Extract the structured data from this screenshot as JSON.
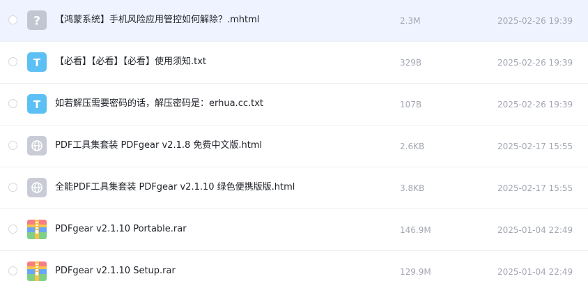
{
  "files": [
    {
      "name": "【鸿蒙系统】手机风险应用管控如何解除？.mhtml",
      "size": "2.3M",
      "date": "2025-02-26 19:39",
      "icon": "unknown-file-icon",
      "selected": true
    },
    {
      "name": "【必看】【必看】【必看】使用须知.txt",
      "size": "329B",
      "date": "2025-02-26 19:39",
      "icon": "text-file-icon",
      "selected": false
    },
    {
      "name": "如若解压需要密码的话，解压密码是：erhua.cc.txt",
      "size": "107B",
      "date": "2025-02-26 19:39",
      "icon": "text-file-icon",
      "selected": false
    },
    {
      "name": "PDF工具集套装 PDFgear v2.1.8 免费中文版.html",
      "size": "2.6KB",
      "date": "2025-02-17 15:55",
      "icon": "web-file-icon",
      "selected": false
    },
    {
      "name": "全能PDF工具集套装 PDFgear v2.1.10 绿色便携版版.html",
      "size": "3.8KB",
      "date": "2025-02-17 15:55",
      "icon": "web-file-icon",
      "selected": false
    },
    {
      "name": "PDFgear v2.1.10 Portable.rar",
      "size": "146.9M",
      "date": "2025-01-04 22:49",
      "icon": "archive-file-icon",
      "selected": false
    },
    {
      "name": "PDFgear v2.1.10 Setup.rar",
      "size": "129.9M",
      "date": "2025-01-04 22:49",
      "icon": "archive-file-icon",
      "selected": false
    }
  ],
  "colors": {
    "selected_row_bg": "#eef3ff",
    "text_icon": "#5cc0f4",
    "unknown_icon": "#c2c6d0",
    "web_icon": "#c9ccd6"
  }
}
